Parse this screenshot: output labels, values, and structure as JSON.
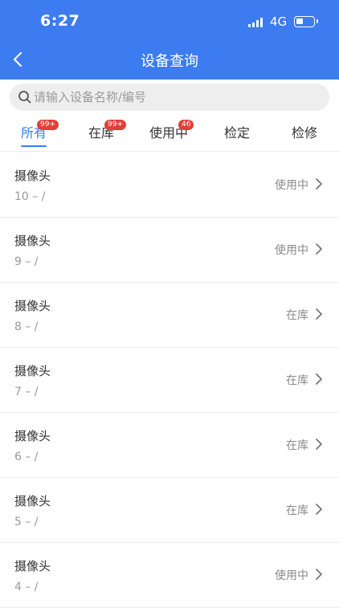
{
  "status_bar": {
    "time": "6:27",
    "network": "4G"
  },
  "nav": {
    "title": "设备查询"
  },
  "search": {
    "placeholder": "请输入设备名称/编号"
  },
  "tabs": [
    {
      "label": "所有",
      "badge": "99+",
      "active": true
    },
    {
      "label": "在库",
      "badge": "99+",
      "active": false
    },
    {
      "label": "使用中",
      "badge": "46",
      "active": false
    },
    {
      "label": "检定",
      "badge": "",
      "active": false
    },
    {
      "label": "检修",
      "badge": "",
      "active": false
    }
  ],
  "items": [
    {
      "name": "摄像头",
      "code": "10 – /",
      "status": "使用中"
    },
    {
      "name": "摄像头",
      "code": "9 – /",
      "status": "使用中"
    },
    {
      "name": "摄像头",
      "code": "8 – /",
      "status": "在库"
    },
    {
      "name": "摄像头",
      "code": "7 – /",
      "status": "在库"
    },
    {
      "name": "摄像头",
      "code": "6 – /",
      "status": "在库"
    },
    {
      "name": "摄像头",
      "code": "5 – /",
      "status": "在库"
    },
    {
      "name": "摄像头",
      "code": "4 – /",
      "status": "使用中"
    }
  ],
  "colors": {
    "accent": "#3c7cf0",
    "badge": "#e0403a"
  }
}
